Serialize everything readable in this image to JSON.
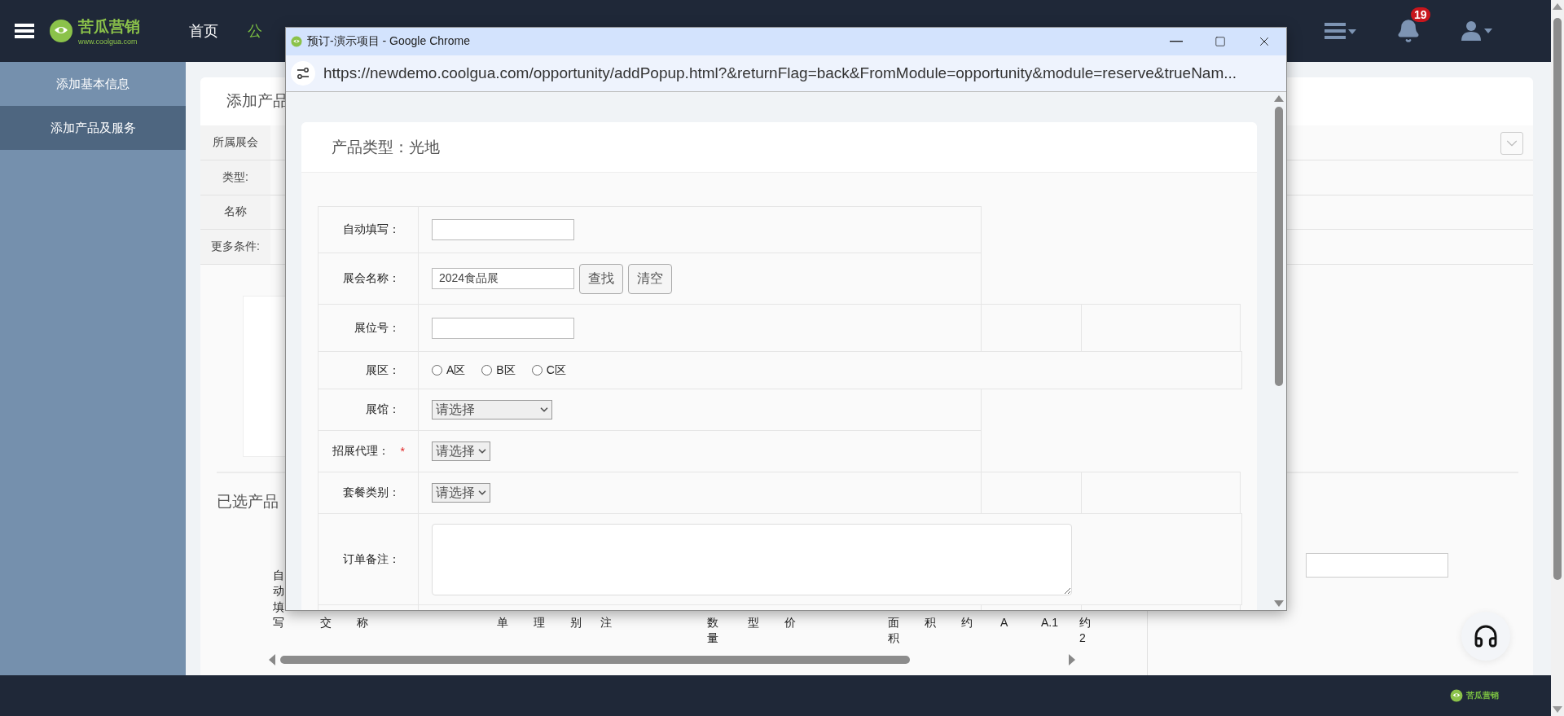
{
  "top_bar": {
    "logo": {
      "name": "苦瓜营销",
      "url": "www.coolgua.com"
    },
    "nav": [
      {
        "label": "首页",
        "selected": false
      },
      {
        "label": "公",
        "selected": true
      }
    ],
    "notifications": "19"
  },
  "sidebar": {
    "items": [
      {
        "label": "添加基本信息",
        "selected": false
      },
      {
        "label": "添加产品及服务",
        "selected": true
      }
    ]
  },
  "main": {
    "title": "添加产品",
    "filters": [
      {
        "label": "所属展会"
      },
      {
        "label": "类型:"
      },
      {
        "label": "名称"
      },
      {
        "label": "更多条件:"
      }
    ],
    "selected_title": "已选产品",
    "columns": [
      {
        "text": "自动填写",
        "kind": "full"
      },
      {
        "text": "交",
        "kind": "tail"
      },
      {
        "text": "称",
        "kind": "tail"
      },
      {
        "text": "单",
        "kind": "tail"
      },
      {
        "text": "理",
        "kind": "tail"
      },
      {
        "text": "别",
        "kind": "tail"
      },
      {
        "text": "注",
        "kind": "tail"
      },
      {
        "text": "数量",
        "kind": "tail"
      },
      {
        "text": "型",
        "kind": "tail"
      },
      {
        "text": "价",
        "kind": "tail"
      },
      {
        "text": "面积",
        "kind": "tail"
      },
      {
        "text": "积",
        "kind": "tail"
      },
      {
        "text": "约",
        "kind": "tail"
      },
      {
        "text": "A",
        "kind": "tail"
      },
      {
        "text": "A.1",
        "kind": "wide"
      },
      {
        "text": "约2",
        "kind": "tail"
      }
    ]
  },
  "footer": {
    "logo": "苦瓜营销"
  },
  "popup": {
    "title": "预订-演示项目 - Google Chrome",
    "url": "https://newdemo.coolgua.com/opportunity/addPopup.html?&returnFlag=back&FromModule=opportunity&module=reserve&trueNam...",
    "heading": "产品类型：光地",
    "rows": [
      {
        "label": "自动填写：",
        "kind": "input"
      },
      {
        "label": "展会名称：",
        "kind": "lookup",
        "value": "2024食品展",
        "buttons": [
          "查找",
          "清空"
        ]
      },
      {
        "label": "展位号：",
        "kind": "input"
      },
      {
        "label": "展区：",
        "kind": "radio",
        "options": [
          {
            "label": "A区",
            "selected": false
          },
          {
            "label": "B区",
            "selected": false
          },
          {
            "label": "C区",
            "selected": false
          }
        ]
      },
      {
        "label": "展馆：",
        "kind": "select_wide",
        "value": "请选择"
      },
      {
        "label": "招展代理：",
        "kind": "select",
        "value": "请选择",
        "required_mark": "*"
      },
      {
        "label": "套餐类别：",
        "kind": "select",
        "value": "请选择"
      },
      {
        "label": "订单备注：",
        "kind": "textarea"
      }
    ]
  }
}
